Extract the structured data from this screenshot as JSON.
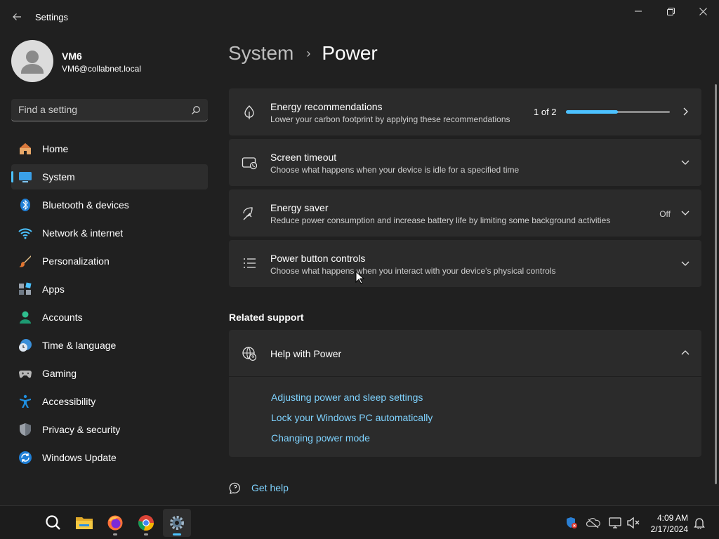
{
  "window": {
    "title": "Settings"
  },
  "user": {
    "name": "VM6",
    "email": "VM6@collabnet.local"
  },
  "search": {
    "placeholder": "Find a setting"
  },
  "sidebar": {
    "items": [
      {
        "label": "Home",
        "icon": "home-icon",
        "active": false
      },
      {
        "label": "System",
        "icon": "system-icon",
        "active": true
      },
      {
        "label": "Bluetooth & devices",
        "icon": "bluetooth-icon",
        "active": false
      },
      {
        "label": "Network & internet",
        "icon": "wifi-icon",
        "active": false
      },
      {
        "label": "Personalization",
        "icon": "brush-icon",
        "active": false
      },
      {
        "label": "Apps",
        "icon": "apps-icon",
        "active": false
      },
      {
        "label": "Accounts",
        "icon": "accounts-icon",
        "active": false
      },
      {
        "label": "Time & language",
        "icon": "clock-globe-icon",
        "active": false
      },
      {
        "label": "Gaming",
        "icon": "gamepad-icon",
        "active": false
      },
      {
        "label": "Accessibility",
        "icon": "accessibility-icon",
        "active": false
      },
      {
        "label": "Privacy & security",
        "icon": "shield-icon",
        "active": false
      },
      {
        "label": "Windows Update",
        "icon": "update-icon",
        "active": false
      }
    ]
  },
  "breadcrumb": {
    "parent": "System",
    "separator": "›",
    "current": "Power"
  },
  "cards": {
    "energy_recommendations": {
      "title": "Energy recommendations",
      "description": "Lower your carbon footprint by applying these recommendations",
      "progress_text": "1 of 2",
      "progress_fraction": 0.5
    },
    "screen_timeout": {
      "title": "Screen timeout",
      "description": "Choose what happens when your device is idle for a specified time"
    },
    "energy_saver": {
      "title": "Energy saver",
      "description": "Reduce power consumption and increase battery life by limiting some background activities",
      "state": "Off"
    },
    "power_button_controls": {
      "title": "Power button controls",
      "description": "Choose what happens when you interact with your device's physical controls"
    }
  },
  "related_support": {
    "heading": "Related support",
    "help_title": "Help with Power",
    "links": [
      "Adjusting power and sleep settings",
      "Lock your Windows PC automatically",
      "Changing power mode"
    ]
  },
  "get_help": {
    "label": "Get help"
  },
  "taskbar": {
    "apps": [
      "search-icon",
      "file-explorer-icon",
      "firefox-icon",
      "chrome-icon",
      "settings-icon"
    ],
    "tray": [
      "defender-icon",
      "onedrive-icon",
      "network-icon",
      "volume-muted-icon",
      "notification-bell-icon"
    ],
    "time": "4:09 AM",
    "date": "2/17/2024"
  },
  "colors": {
    "accent": "#4cc2ff",
    "link": "#7fd3ff",
    "background": "#202020",
    "card": "#2b2b2b"
  }
}
